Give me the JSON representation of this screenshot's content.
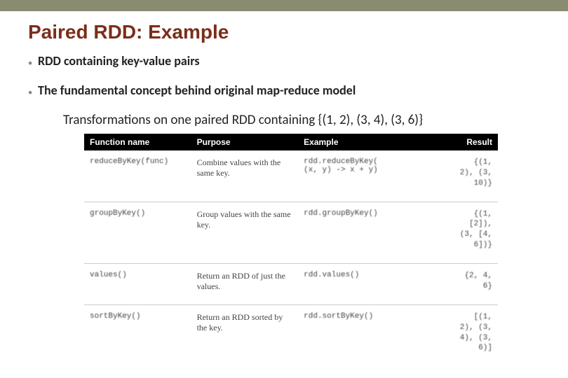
{
  "title": "Paired RDD: Example",
  "bullets": [
    "RDD containing key-value pairs",
    "The fundamental concept behind original map-reduce model"
  ],
  "subtitle": "Transformations on one paired RDD containing {(1, 2), (3, 4), (3, 6)}",
  "table": {
    "headers": [
      "Function name",
      "Purpose",
      "Example",
      "Result"
    ],
    "rows": [
      {
        "fn": "reduceByKey(func)",
        "purpose": "Combine values with the same key.",
        "example": "rdd.reduceByKey(\n(x, y) -> x + y)",
        "result": "{(1,\n2), (3,\n10)}"
      },
      {
        "fn": "groupByKey()",
        "purpose": "Group values with the same key.",
        "example": "rdd.groupByKey()",
        "result": "{(1,\n[2]),\n(3, [4,\n6])}"
      },
      {
        "fn": "values()",
        "purpose": "Return an RDD of just the values.",
        "example": "rdd.values()",
        "result": "{2, 4,\n6}"
      },
      {
        "fn": "sortByKey()",
        "purpose": "Return an RDD sorted by the key.",
        "example": "rdd.sortByKey()",
        "result": "[(1,\n2), (3,\n4), (3,\n6)]"
      }
    ]
  }
}
